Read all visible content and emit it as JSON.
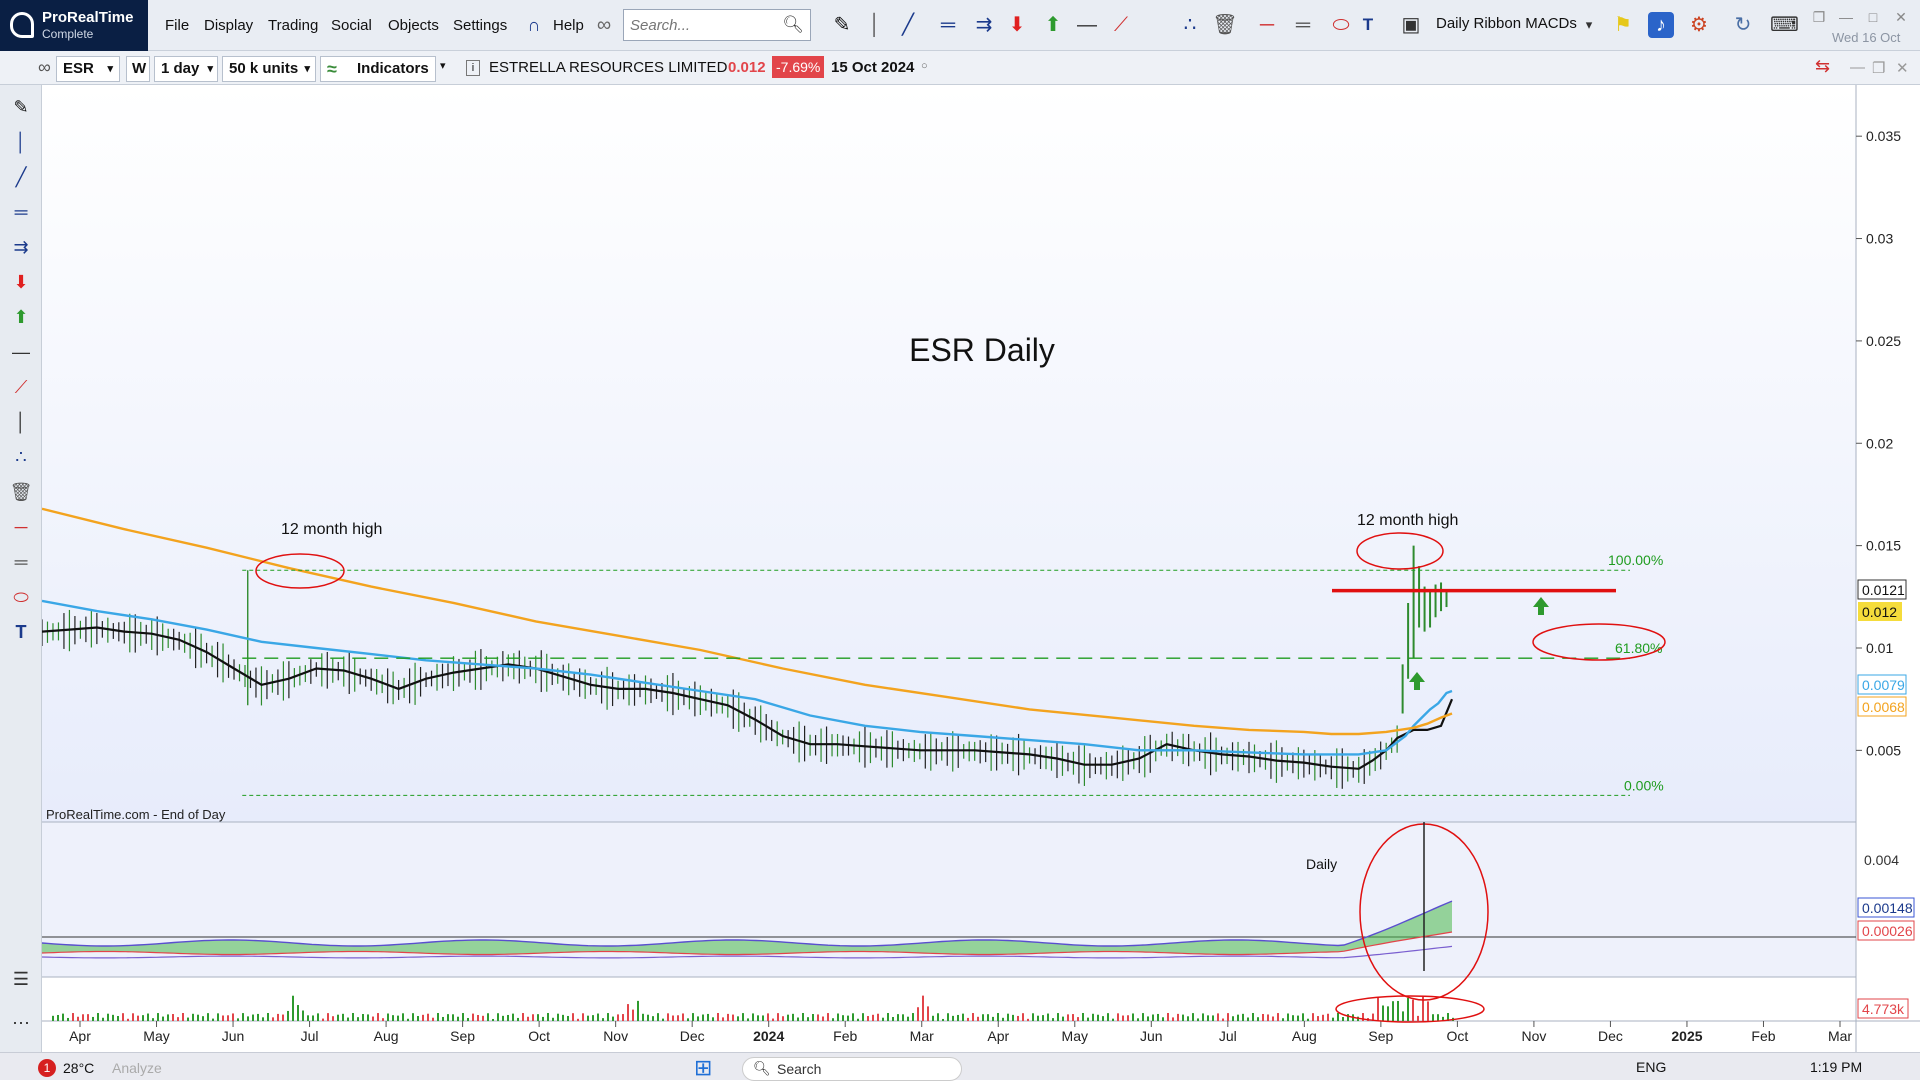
{
  "app": {
    "name": "ProRealTime",
    "edition": "Complete",
    "menus": [
      "File",
      "Display",
      "Trading",
      "Social",
      "Objects",
      "Settings",
      "Help"
    ],
    "search_placeholder": "Search...",
    "ribbon_name": "Daily Ribbon MACDs",
    "date": "Wed 16 Oct"
  },
  "instrument_bar": {
    "ticker": "ESR",
    "timeframe_w": "W",
    "timeframe": "1 day",
    "units": "50 k units",
    "indicators_label": "Indicators",
    "company": "ESTRELLA RESOURCES LIMITED",
    "last_price": "0.012",
    "change": "-7.69%",
    "date": "15 Oct 2024"
  },
  "colors": {
    "accent": "#1b3a8c",
    "down": "#e2454a",
    "up": "#2e8b2e",
    "ma_short": "#111111",
    "ma_mid": "#3aa7e6",
    "ma_long": "#f3a31e",
    "resistance": "#e01010",
    "fib": "#1f9c1f"
  },
  "chart_data": {
    "type": "line",
    "title": "ESR Daily",
    "source_label": "ProRealTime.com - End of Day",
    "x_ticks": [
      "Apr",
      "May",
      "Jun",
      "Jul",
      "Aug",
      "Sep",
      "Oct",
      "Nov",
      "Dec",
      "2024",
      "Feb",
      "Mar",
      "Apr",
      "May",
      "Jun",
      "Jul",
      "Aug",
      "Sep",
      "Oct",
      "Nov",
      "Dec",
      "2025",
      "Feb",
      "Mar"
    ],
    "y_ticks": [
      "0.035",
      "0.03",
      "0.025",
      "0.02",
      "0.015",
      "0.01",
      "0.005"
    ],
    "ylim": [
      0.0015,
      0.0375
    ],
    "price_labels": {
      "close": "0.0121",
      "last": "0.012",
      "ma_mid": "0.0079",
      "ma_long": "0.0068"
    },
    "annotations": {
      "high_left": "12 month high",
      "high_right": "12 month high",
      "fib_100": "100.00%",
      "fib_618": "61.80%",
      "fib_0": "0.00%",
      "panel_label": "Daily"
    },
    "levels": {
      "fib_100": 0.0138,
      "fib_618": 0.0095,
      "fib_0": 0.0028,
      "resistance": 0.0128
    },
    "series": [
      {
        "x": [
          0,
          10,
          20,
          30,
          40,
          50,
          60,
          70,
          80,
          90,
          100,
          110,
          120,
          130,
          140,
          150,
          160,
          170,
          180,
          190,
          200,
          210,
          220,
          230,
          240,
          250,
          260,
          270,
          280,
          290,
          300,
          310,
          320,
          330,
          340,
          350,
          360,
          370,
          380,
          390,
          400,
          410,
          420,
          430,
          440,
          450,
          460,
          470,
          480,
          485,
          490,
          494,
          497,
          500,
          505,
          510,
          514
        ],
        "values": [
          0.0108,
          0.0109,
          0.011,
          0.0108,
          0.0107,
          0.0104,
          0.0098,
          0.009,
          0.0082,
          0.0085,
          0.009,
          0.0089,
          0.0085,
          0.008,
          0.0085,
          0.0088,
          0.009,
          0.0092,
          0.009,
          0.0086,
          0.0082,
          0.008,
          0.008,
          0.0078,
          0.0075,
          0.0072,
          0.0065,
          0.0057,
          0.0053,
          0.0053,
          0.0052,
          0.0051,
          0.005,
          0.005,
          0.005,
          0.0049,
          0.0048,
          0.0046,
          0.0043,
          0.0043,
          0.0046,
          0.0053,
          0.005,
          0.0048,
          0.0047,
          0.0045,
          0.0044,
          0.0042,
          0.0041,
          0.0045,
          0.005,
          0.0056,
          0.0058,
          0.006,
          0.006,
          0.0062,
          0.0075
        ]
      },
      {
        "x": [
          0,
          20,
          40,
          60,
          80,
          100,
          120,
          140,
          160,
          180,
          200,
          220,
          240,
          260,
          280,
          300,
          320,
          340,
          360,
          380,
          400,
          420,
          440,
          460,
          480,
          490,
          497,
          500,
          503,
          506,
          509,
          512,
          514
        ],
        "values": [
          0.0123,
          0.0118,
          0.0114,
          0.0109,
          0.0103,
          0.01,
          0.0097,
          0.0094,
          0.0092,
          0.009,
          0.0087,
          0.0083,
          0.0079,
          0.0075,
          0.0067,
          0.0062,
          0.0059,
          0.0057,
          0.0055,
          0.0053,
          0.005,
          0.005,
          0.0049,
          0.0048,
          0.0048,
          0.005,
          0.0057,
          0.0062,
          0.0066,
          0.007,
          0.0073,
          0.0078,
          0.0079
        ]
      },
      {
        "x": [
          0,
          30,
          60,
          90,
          120,
          150,
          180,
          210,
          240,
          270,
          300,
          330,
          360,
          390,
          420,
          440,
          460,
          470,
          480,
          490,
          500,
          505,
          510,
          514
        ],
        "values": [
          0.0168,
          0.0158,
          0.0149,
          0.0139,
          0.013,
          0.0122,
          0.0113,
          0.0106,
          0.0099,
          0.009,
          0.0082,
          0.0076,
          0.007,
          0.0066,
          0.0062,
          0.006,
          0.0059,
          0.0058,
          0.0058,
          0.0059,
          0.0061,
          0.0063,
          0.0066,
          0.0068
        ]
      }
    ],
    "macd_panel": {
      "y_ticks": [
        "0.004"
      ],
      "labels": [
        "0.00148",
        "0.00026"
      ]
    },
    "volume_panel": {
      "label": "4.773k"
    }
  },
  "left_toolbar": [
    "pencil-icon",
    "vline-icon",
    "trend-icon",
    "hline-icon",
    "arrow-line-icon",
    "sell-arrow-icon",
    "buy-arrow-icon",
    "horizontal-line-icon",
    "segment-icon",
    "vertical-line-icon",
    "fib-icon",
    "trash-icon",
    "red-line-icon",
    "ruler-icon",
    "ellipse-icon",
    "text-icon"
  ],
  "status_bar": {
    "temperature": "28°C",
    "notification_count": "1",
    "analyze": "Analyze",
    "search": "Search",
    "lang": "ENG",
    "time": "1:19 PM"
  }
}
